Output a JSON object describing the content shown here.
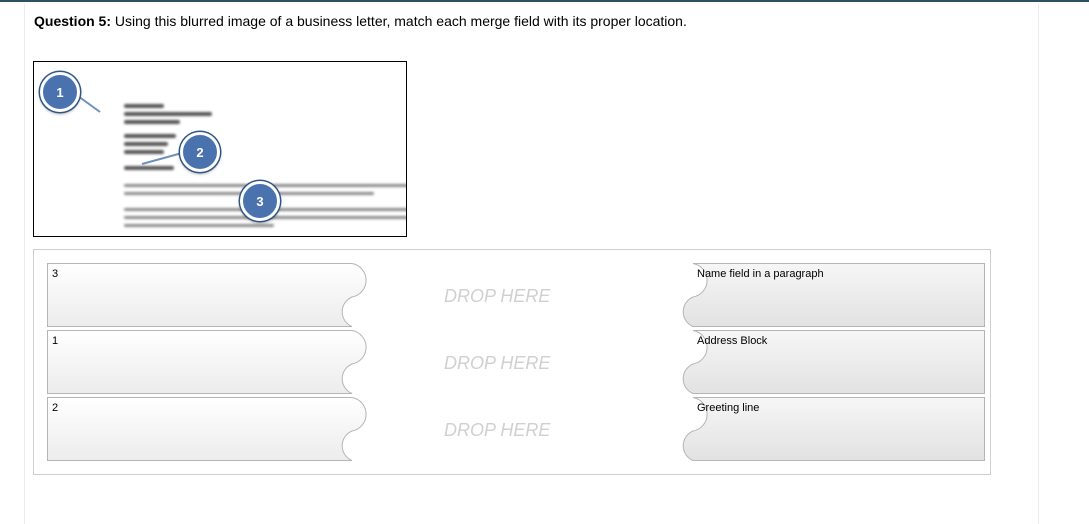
{
  "question": {
    "label": "Question 5:",
    "text": " Using this blurred image of a business letter, match each merge field with its proper location."
  },
  "callouts": [
    "1",
    "2",
    "3"
  ],
  "prompts": [
    "3",
    "1",
    "2"
  ],
  "drop_placeholder": "DROP HERE",
  "answers": [
    "Name field in a paragraph",
    "Address Block",
    "Greeting line"
  ],
  "colors": {
    "callout_fill": "#4a72ae",
    "top_border": "#2e4f66",
    "drop_text": "#d0d0d0"
  }
}
